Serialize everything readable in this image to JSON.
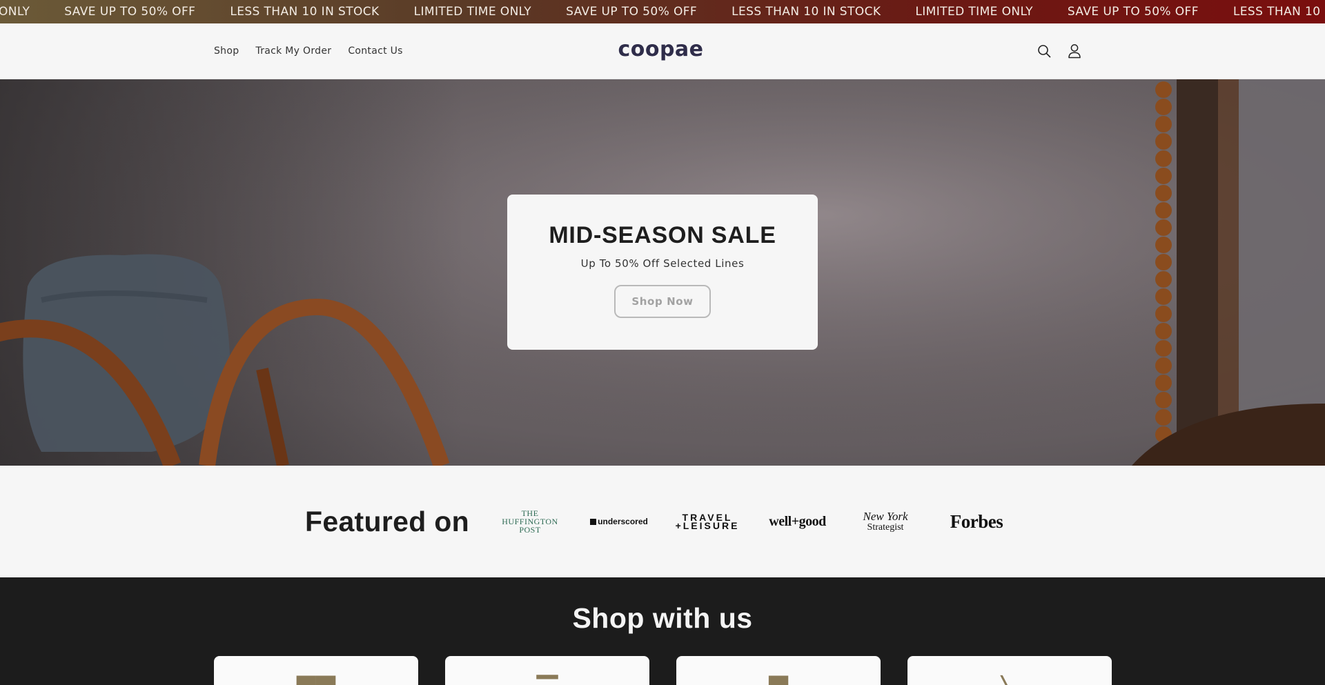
{
  "announcement": {
    "items": [
      "ONLY",
      "SAVE UP TO 50% OFF",
      "LESS THAN 10 IN STOCK",
      "LIMITED TIME ONLY",
      "SAVE UP TO 50% OFF",
      "LESS THAN 10 IN STOCK",
      "LIMITED TIME ONLY",
      "SAVE UP TO 50% OFF",
      "LESS THAN 10 IN"
    ]
  },
  "header": {
    "nav": [
      "Shop",
      "Track My Order",
      "Contact Us"
    ],
    "logo": "coopae",
    "icons": [
      "search-icon",
      "account-icon"
    ]
  },
  "hero": {
    "title": "MID-SEASON SALE",
    "subtitle": "Up To 50% Off Selected Lines",
    "button": "Shop Now"
  },
  "featured": {
    "title": "Featured on",
    "logos": {
      "huffington": [
        "THE",
        "HUFFINGTON",
        "POST"
      ],
      "underscored": "underscored",
      "travel": [
        "TRAVEL",
        "+LEISURE"
      ],
      "wellgood": "well+good",
      "newyork": [
        "New York",
        "Strategist"
      ],
      "forbes": "Forbes"
    }
  },
  "shop": {
    "title": "Shop with us"
  },
  "colors": {
    "logo": "#2f2d4a",
    "dark_section": "#1c1c1c",
    "marquee_start": "#6b5a38",
    "marquee_end": "#7a0e0e"
  }
}
